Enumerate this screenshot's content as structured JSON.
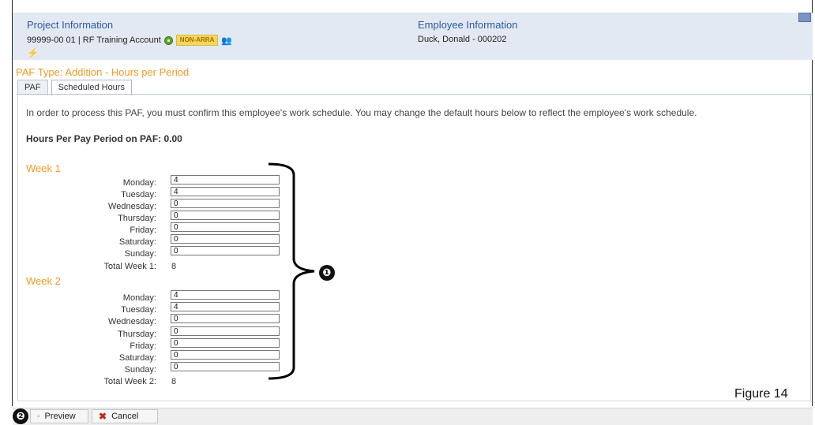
{
  "project": {
    "title": "Project Information",
    "account": "99999-00 01 | RF Training Account",
    "badge": "NON-ARRA",
    "icons": [
      "status-ok-icon",
      "people-icon",
      "lightning-icon"
    ]
  },
  "employee": {
    "title": "Employee Information",
    "name": "Duck, Donald - 000202"
  },
  "paf_type": "PAF Type: Addition - Hours per Period",
  "tabs": [
    {
      "label": "PAF",
      "active": false
    },
    {
      "label": "Scheduled Hours",
      "active": true
    }
  ],
  "intro": "In order to process this PAF, you must confirm this employee's work schedule. You may change the default hours below to reflect the employee's work schedule.",
  "hours_per_period": "Hours Per Pay Period on PAF: 0.00",
  "weeks": [
    {
      "title": "Week 1",
      "days": [
        {
          "label": "Monday:",
          "value": "4"
        },
        {
          "label": "Tuesday:",
          "value": "4"
        },
        {
          "label": "Wednesday:",
          "value": "0"
        },
        {
          "label": "Thursday:",
          "value": "0"
        },
        {
          "label": "Friday:",
          "value": "0"
        },
        {
          "label": "Saturday:",
          "value": "0"
        },
        {
          "label": "Sunday:",
          "value": "0"
        }
      ],
      "total_label": "Total Week 1:",
      "total_value": "8"
    },
    {
      "title": "Week 2",
      "days": [
        {
          "label": "Monday:",
          "value": "4"
        },
        {
          "label": "Tuesday:",
          "value": "4"
        },
        {
          "label": "Wednesday:",
          "value": "0"
        },
        {
          "label": "Thursday:",
          "value": "0"
        },
        {
          "label": "Friday:",
          "value": "0"
        },
        {
          "label": "Saturday:",
          "value": "0"
        },
        {
          "label": "Sunday:",
          "value": "0"
        }
      ],
      "total_label": "Total Week 2:",
      "total_value": "8"
    }
  ],
  "callouts": [
    "❶",
    "❷"
  ],
  "figure_label": "Figure 14",
  "footer": {
    "preview_label": "Preview",
    "cancel_label": "Cancel"
  },
  "colors": {
    "accent_orange": "#f29b24",
    "header_blue": "#2c5aa0",
    "panel_bg": "#e3e9f3"
  }
}
